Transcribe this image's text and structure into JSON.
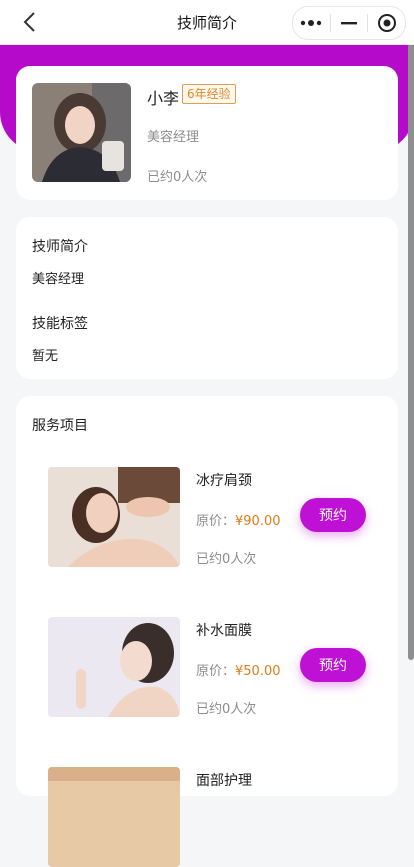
{
  "nav": {
    "title": "技师简介"
  },
  "profile": {
    "name": "小李",
    "experience": "6年经验",
    "role": "美容经理",
    "visits": "已约0人次"
  },
  "intro": {
    "intro_heading": "技师简介",
    "intro_value": "美容经理",
    "tags_heading": "技能标签",
    "tags_value": "暂无"
  },
  "services": {
    "title": "服务项目",
    "items": [
      {
        "name": "冰疗肩颈",
        "price_label": "原价：",
        "price": "¥90.00",
        "booked": "已约0人次",
        "button": "预约"
      },
      {
        "name": "补水面膜",
        "price_label": "原价：",
        "price": "¥50.00",
        "booked": "已约0人次",
        "button": "预约"
      },
      {
        "name": "面部护理"
      }
    ]
  },
  "colors": {
    "brand_purple": "#b60acb",
    "button_purple": "#bf11d6",
    "price_orange": "#e07b18"
  }
}
